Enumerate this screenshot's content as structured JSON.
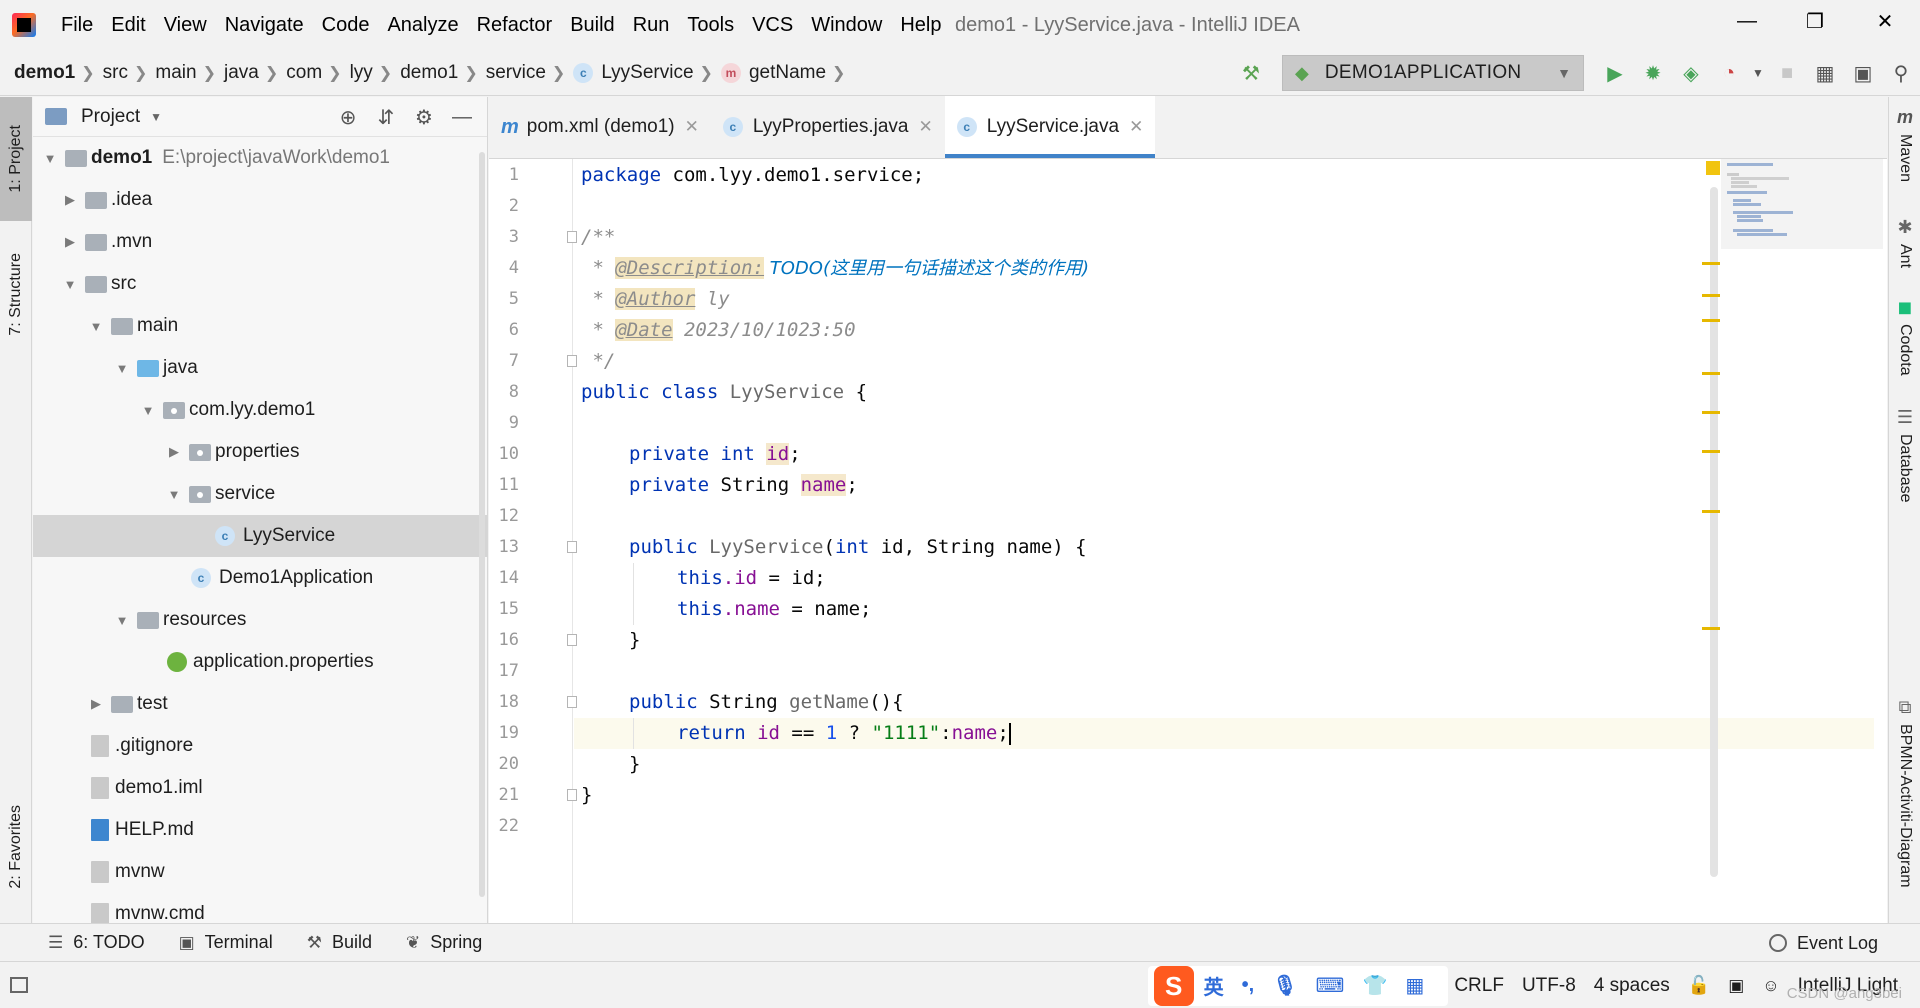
{
  "menu": {
    "items": [
      "File",
      "Edit",
      "View",
      "Navigate",
      "Code",
      "Analyze",
      "Refactor",
      "Build",
      "Run",
      "Tools",
      "VCS",
      "Window",
      "Help"
    ],
    "window_title": "demo1 - LyyService.java - IntelliJ IDEA"
  },
  "window_controls": {
    "minimize": "—",
    "restore": "❐",
    "close": "✕"
  },
  "breadcrumb": [
    {
      "label": "demo1"
    },
    {
      "label": "src"
    },
    {
      "label": "main"
    },
    {
      "label": "java"
    },
    {
      "label": "com"
    },
    {
      "label": "lyy"
    },
    {
      "label": "demo1"
    },
    {
      "label": "service"
    },
    {
      "label": "LyyService"
    },
    {
      "label": "getName"
    }
  ],
  "run_config": {
    "label": "DEMO1APPLICATION"
  },
  "left_strip": {
    "project": "1: Project",
    "structure": "7: Structure",
    "favorites": "2: Favorites"
  },
  "project_panel": {
    "title": "Project",
    "root": {
      "name": "demo1",
      "path": "E:\\project\\javaWork\\demo1"
    },
    "tree": [
      {
        "label": ".idea"
      },
      {
        "label": ".mvn"
      },
      {
        "label": "src"
      },
      {
        "label": "main"
      },
      {
        "label": "java"
      },
      {
        "label": "com.lyy.demo1"
      },
      {
        "label": "properties"
      },
      {
        "label": "service"
      },
      {
        "label": "LyyService"
      },
      {
        "label": "Demo1Application"
      },
      {
        "label": "resources"
      },
      {
        "label": "application.properties"
      },
      {
        "label": "test"
      },
      {
        "label": ".gitignore"
      },
      {
        "label": "demo1.iml"
      },
      {
        "label": "HELP.md"
      },
      {
        "label": "mvnw"
      },
      {
        "label": "mvnw.cmd"
      }
    ]
  },
  "editor": {
    "tabs": [
      {
        "label": "pom.xml (demo1)"
      },
      {
        "label": "LyyProperties.java"
      },
      {
        "label": "LyyService.java"
      }
    ],
    "line_numbers": [
      "1",
      "2",
      "3",
      "4",
      "5",
      "6",
      "7",
      "8",
      "9",
      "10",
      "11",
      "12",
      "13",
      "14",
      "15",
      "16",
      "17",
      "18",
      "19",
      "20",
      "21",
      "22"
    ],
    "code": {
      "l1_kw": "package",
      "l1_rest": " com.lyy.demo1.service;",
      "l3": "/**",
      "l4_star": " * ",
      "l4_tag": "@Description:",
      "l4_todo": " TODO(这里用一句话描述这个类的作用)",
      "l5_star": " * ",
      "l5_tag": "@Author",
      "l5_val": " ly",
      "l6_star": " * ",
      "l6_tag": "@Date",
      "l6_val": " 2023/10/1023:50",
      "l7": " */",
      "l8_kw": "public class",
      "l8_cls": " LyyService",
      "l8_rest": " {",
      "l10_kw": "private int",
      "l10_fld": "id",
      "l11_kw": "private",
      "l11_type": " String ",
      "l11_fld": "name",
      "l13_kw": "public",
      "l13_cls": " LyyService",
      "l13_p1": "(",
      "l13_kw2": "int",
      "l13_rest": " id, String name) {",
      "l14_kw": "this",
      "l14_fld": ".id",
      "l14_rest": " = id;",
      "l15_kw": "this",
      "l15_fld": ".name",
      "l15_rest": " = name;",
      "l16": "}",
      "l18_kw": "public",
      "l18_type": " String ",
      "l18_m": "getName",
      "l18_rest": "(){",
      "l19_kw": "return",
      "l19_fld": " id",
      "l19_op": " == ",
      "l19_num": "1",
      "l19_q": " ? ",
      "l19_str": "\"1111\"",
      "l19_colon": ":",
      "l19_fld2": "name",
      "l19_end": ";",
      "l20": "}",
      "l21": "}"
    }
  },
  "right_strip": {
    "maven": "Maven",
    "ant": "Ant",
    "codota": "Codota",
    "database": "Database",
    "bpmn": "BPMN-Activiti-Diagram"
  },
  "bottom_tools": {
    "todo": "6: TODO",
    "terminal": "Terminal",
    "build": "Build",
    "spring": "Spring",
    "event_log": "Event Log"
  },
  "statusbar": {
    "ime_lang": "英",
    "line_sep": "CRLF",
    "encoding": "UTF-8",
    "indent": "4 spaces",
    "theme": "IntelliJ Light",
    "watermark": "CSDN @ang3bei"
  },
  "colors": {
    "accent": "#4083c9",
    "keyword": "#0033b3",
    "field": "#871094",
    "string": "#067d17",
    "number": "#1750eb",
    "todo": "#0073bf",
    "caret_line": "#fcfaed"
  }
}
